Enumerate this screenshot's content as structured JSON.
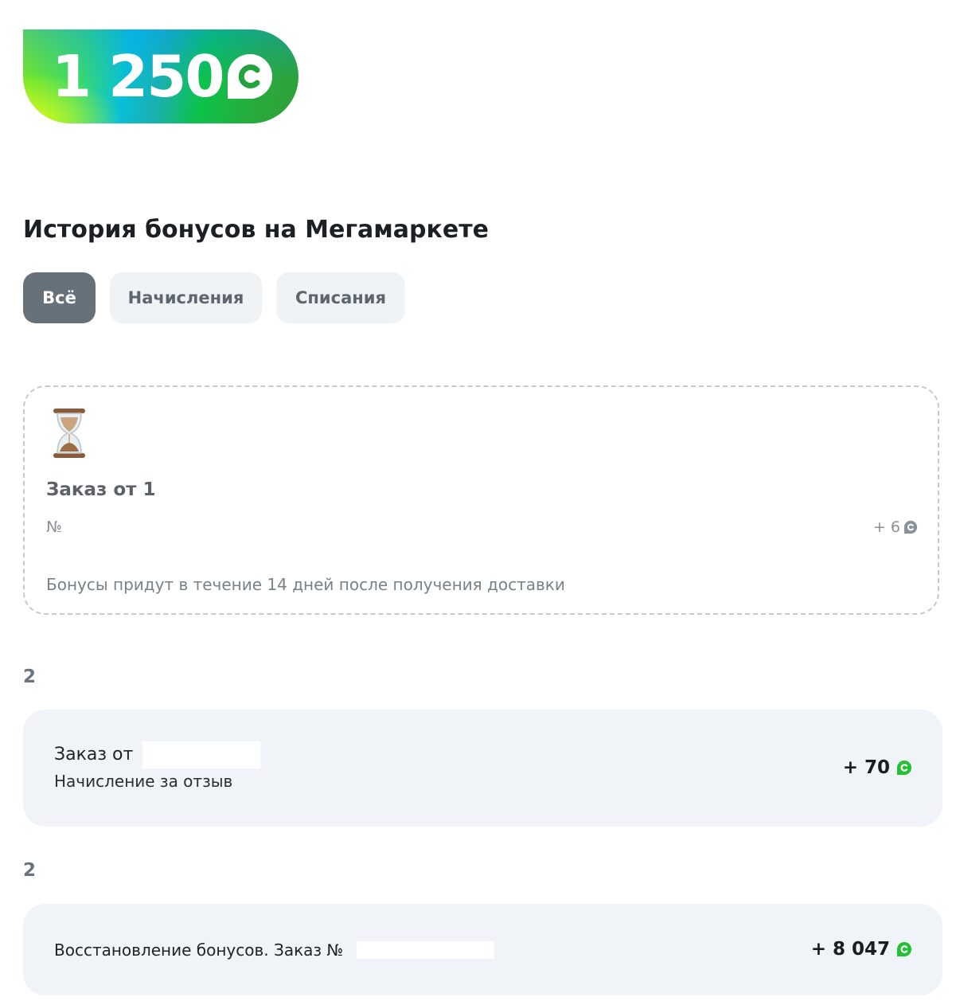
{
  "balance": {
    "value": "1 250",
    "currency_icon": "bonus-coin-icon"
  },
  "history": {
    "title": "История бонусов на Мегамаркете",
    "tabs": [
      {
        "label": "Всё",
        "active": true
      },
      {
        "label": "Начисления",
        "active": false
      },
      {
        "label": "Списания",
        "active": false
      }
    ]
  },
  "pending": {
    "icon": "hourglass-icon",
    "title": "Заказ от 1",
    "number_label": "№",
    "amount": "+ 6",
    "note": "Бонусы придут в течение 14 дней после получения доставки"
  },
  "groups": [
    {
      "date": "2",
      "entry": {
        "title": "Заказ от",
        "subtitle": "Начисление за отзыв",
        "amount": "+ 70"
      }
    },
    {
      "date": "2",
      "entry": {
        "title": "Восстановление бонусов. Заказ №",
        "amount": "+ 8 047"
      }
    }
  ],
  "colors": {
    "coin_green": "#21c133",
    "coin_gray": "#8a9199",
    "tab_active_bg": "#67717a",
    "tab_bg": "#f0f3f6",
    "card_bg": "#f0f3f7"
  }
}
